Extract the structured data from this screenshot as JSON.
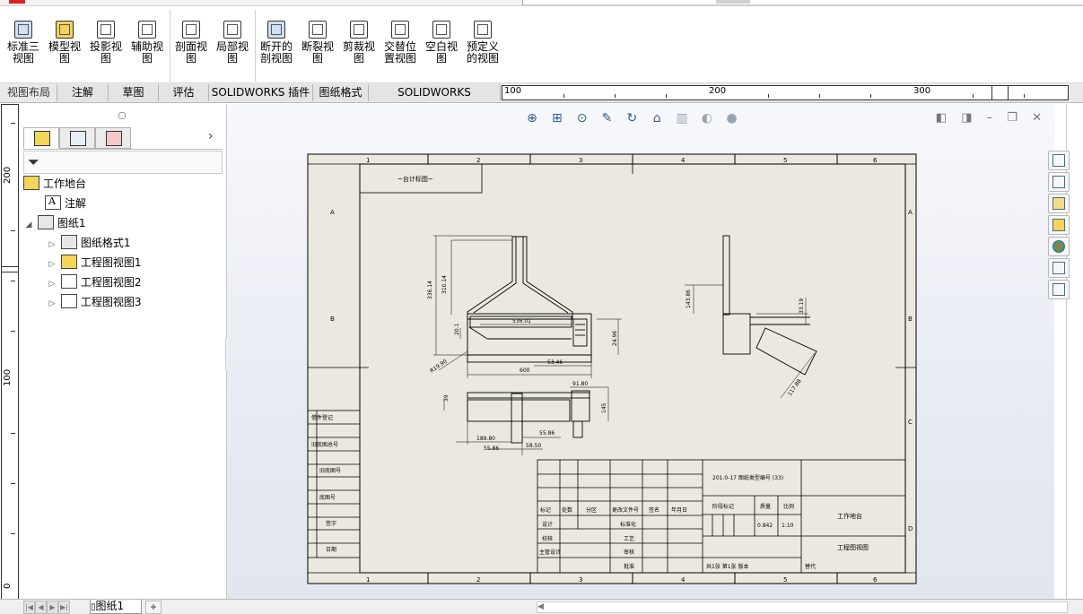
{
  "ribbon": {
    "buttons": [
      {
        "label1": "标准三",
        "label2": "视图",
        "icon": "standard-three-view-icon"
      },
      {
        "label1": "模型视",
        "label2": "图",
        "icon": "model-view-icon"
      },
      {
        "label1": "投影视",
        "label2": "图",
        "icon": "projected-view-icon"
      },
      {
        "label1": "辅助视",
        "label2": "图",
        "icon": "auxiliary-view-icon"
      },
      {
        "label1": "剖面视",
        "label2": "图",
        "icon": "section-view-icon"
      },
      {
        "label1": "局部视",
        "label2": "图",
        "icon": "detail-view-icon"
      },
      {
        "label1": "断开的",
        "label2": "剖视图",
        "icon": "broken-out-section-icon"
      },
      {
        "label1": "断裂视",
        "label2": "图",
        "icon": "break-view-icon"
      },
      {
        "label1": "剪裁视",
        "label2": "图",
        "icon": "crop-view-icon"
      },
      {
        "label1": "交替位",
        "label2": "置视图",
        "icon": "alternate-position-view-icon"
      },
      {
        "label1": "空白视",
        "label2": "图",
        "icon": "empty-view-icon"
      },
      {
        "label1": "预定义",
        "label2": "的视图",
        "icon": "predefined-view-icon"
      }
    ]
  },
  "tabs": [
    "视图布局",
    "注解",
    "草图",
    "评估",
    "SOLIDWORKS 插件",
    "图纸格式",
    "SOLIDWORKS Inspection"
  ],
  "hruler": {
    "labels": [
      "100",
      "200",
      "300"
    ]
  },
  "vruler": {
    "labels": [
      "200",
      "100",
      "0"
    ]
  },
  "tree": {
    "root": "工作地台",
    "items": [
      {
        "label": "注解"
      },
      {
        "label": "图纸1"
      },
      {
        "label": "图纸格式1"
      },
      {
        "label": "工程图视图1"
      },
      {
        "label": "工程图视图2"
      },
      {
        "label": "工程图视图3"
      }
    ]
  },
  "drawing": {
    "column_labels": [
      "1",
      "2",
      "3",
      "4",
      "5",
      "6"
    ],
    "row_labels": [
      "A",
      "B",
      "C",
      "D"
    ],
    "corner_box": "~台计标图~",
    "dims": {
      "d1": "336.14",
      "d2": "310.14",
      "d3": "536.01",
      "d4": "53.46",
      "d5": "600",
      "d6": "R19.90",
      "d7": "91.80",
      "d8": "145",
      "d9": "189.80",
      "d10": "55.86",
      "d11": "55.86",
      "d12": "58.50",
      "d13": "143.86",
      "d14": "33.19",
      "d15": "117.88",
      "d16": "24.96",
      "d17": "20.1",
      "d18": "39"
    },
    "left_table": [
      "借件登记",
      "旧底图总号",
      "旧底图号",
      "底图号",
      "签字",
      "日期"
    ],
    "title_block": {
      "doc_no": "201.0-17 图纸类型编号 (33)",
      "name": "工作地台",
      "drawing_type": "工程图视图",
      "scale": "1:10",
      "weight": "0.842",
      "row_labels": [
        "标记",
        "处数",
        "分区",
        "更改文件号",
        "签名",
        "年月日"
      ],
      "roles": [
        "设计",
        "校核",
        "主管设计"
      ],
      "roles2": [
        "标准化",
        "工艺",
        "审核",
        "批准"
      ],
      "stage_header": [
        "阶段标记",
        "质量",
        "比例"
      ],
      "sheet_text": "共1张 第1张 版本",
      "company": "替代"
    }
  },
  "status": {
    "sheet_tab": "图纸1"
  }
}
